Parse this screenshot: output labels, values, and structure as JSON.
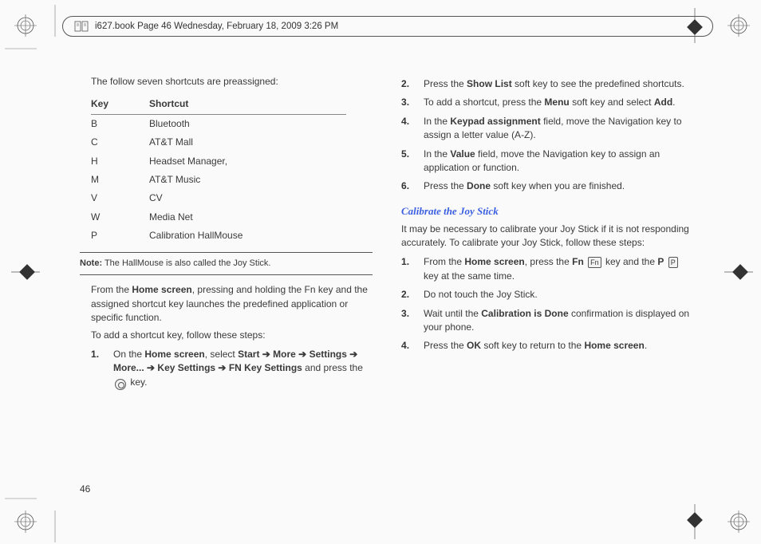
{
  "header": {
    "text": "i627.book  Page 46  Wednesday, February 18, 2009  3:26 PM"
  },
  "page_number": "46",
  "left": {
    "intro": "The follow seven shortcuts are preassigned:",
    "table": {
      "head": {
        "key": "Key",
        "shortcut": "Shortcut"
      },
      "rows": [
        {
          "key": "B",
          "shortcut": "Bluetooth"
        },
        {
          "key": "C",
          "shortcut": "AT&T Mall"
        },
        {
          "key": "H",
          "shortcut": "Headset Manager,"
        },
        {
          "key": "M",
          "shortcut": "AT&T Music"
        },
        {
          "key": "V",
          "shortcut": "CV"
        },
        {
          "key": "W",
          "shortcut": "Media Net"
        },
        {
          "key": "P",
          "shortcut": "Calibration HallMouse"
        }
      ]
    },
    "note": {
      "label": "Note:",
      "text": " The HallMouse is also called the Joy Stick."
    },
    "para1_a": "From the ",
    "para1_b": "Home screen",
    "para1_c": ", pressing and holding the Fn key and the assigned shortcut key launches the predefined application or specific function.",
    "para2": "To add a shortcut key, follow these steps:",
    "step1": {
      "a": "On the ",
      "b": "Home screen",
      "c": ", select ",
      "d": "Start",
      "e": " ➔ ",
      "f": "More",
      "g": " ➔ ",
      "h": "Settings",
      "i": " ➔ ",
      "j": "More...",
      "k": " ➔ ",
      "l": "Key Settings",
      "m": " ➔ ",
      "n": "FN Key Settings",
      "o": " and press the ",
      "p": " key."
    }
  },
  "right": {
    "step2": {
      "a": "Press the ",
      "b": "Show List",
      "c": " soft key to see the predefined shortcuts."
    },
    "step3": {
      "a": "To add a shortcut, press the ",
      "b": "Menu",
      "c": " soft key and select ",
      "d": "Add",
      "e": "."
    },
    "step4": {
      "a": "In the ",
      "b": "Keypad assignment",
      "c": " field, move the Navigation key to assign a letter value (A-Z)."
    },
    "step5": {
      "a": "In the ",
      "b": "Value",
      "c": " field, move the Navigation key to assign an application or function."
    },
    "step6": {
      "a": "Press the ",
      "b": "Done",
      "c": " soft key when you are finished."
    },
    "calibrate": {
      "title": "Calibrate the Joy Stick",
      "intro": "It may be necessary to calibrate your Joy Stick if it is not responding accurately. To calibrate your Joy Stick, follow these steps:",
      "s1": {
        "a": "From the ",
        "b": "Home screen",
        "c": ", press the ",
        "d": "Fn",
        "e": " ",
        "f": " key and the ",
        "g": "P",
        "h": " ",
        "i": " key at the same time."
      },
      "s2": "Do not touch the Joy Stick.",
      "s3": {
        "a": "Wait until the ",
        "b": "Calibration is Done",
        "c": " confirmation is displayed on your phone."
      },
      "s4": {
        "a": "Press the ",
        "b": "OK",
        "c": " soft key to return to the ",
        "d": "Home screen",
        "e": "."
      }
    }
  },
  "icons": {
    "fn": "Fn",
    "p": "P"
  }
}
